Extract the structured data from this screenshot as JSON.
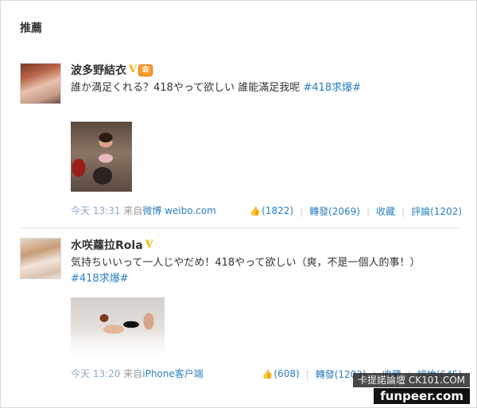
{
  "section_title": "推薦",
  "posts": [
    {
      "author": "波多野結衣",
      "verified": "V",
      "member": "会",
      "text_main": "誰か満足くれる？418やって欲しい 誰能滿足我呢 ",
      "text_tag": "#418求爆#",
      "time": "今天 13:31",
      "source_prefix": "来自",
      "source_link": "微博 weibo.com",
      "likes": "(1822)",
      "repost": "轉發(2069)",
      "favorite": "收藏",
      "comment": "評論(1202)"
    },
    {
      "author": "水咲蘿拉Rola",
      "verified": "V",
      "text_main": "気持ちいいって一人じやだめ！418やって欲しい（爽，不是一個人的事！）",
      "text_tag": "#418求爆#",
      "time": "今天 13:20",
      "source_prefix": "来自",
      "source_link": "iPhone客户端",
      "likes": "(608)",
      "repost": "轉發(1203)",
      "favorite": "收藏",
      "comment": "評論(645)"
    }
  ],
  "watermarks": {
    "line1": "卡提諾論壇 CK101.COM",
    "line2": "funpeer.com"
  },
  "icons": {
    "like": "thumbs-up-icon"
  }
}
